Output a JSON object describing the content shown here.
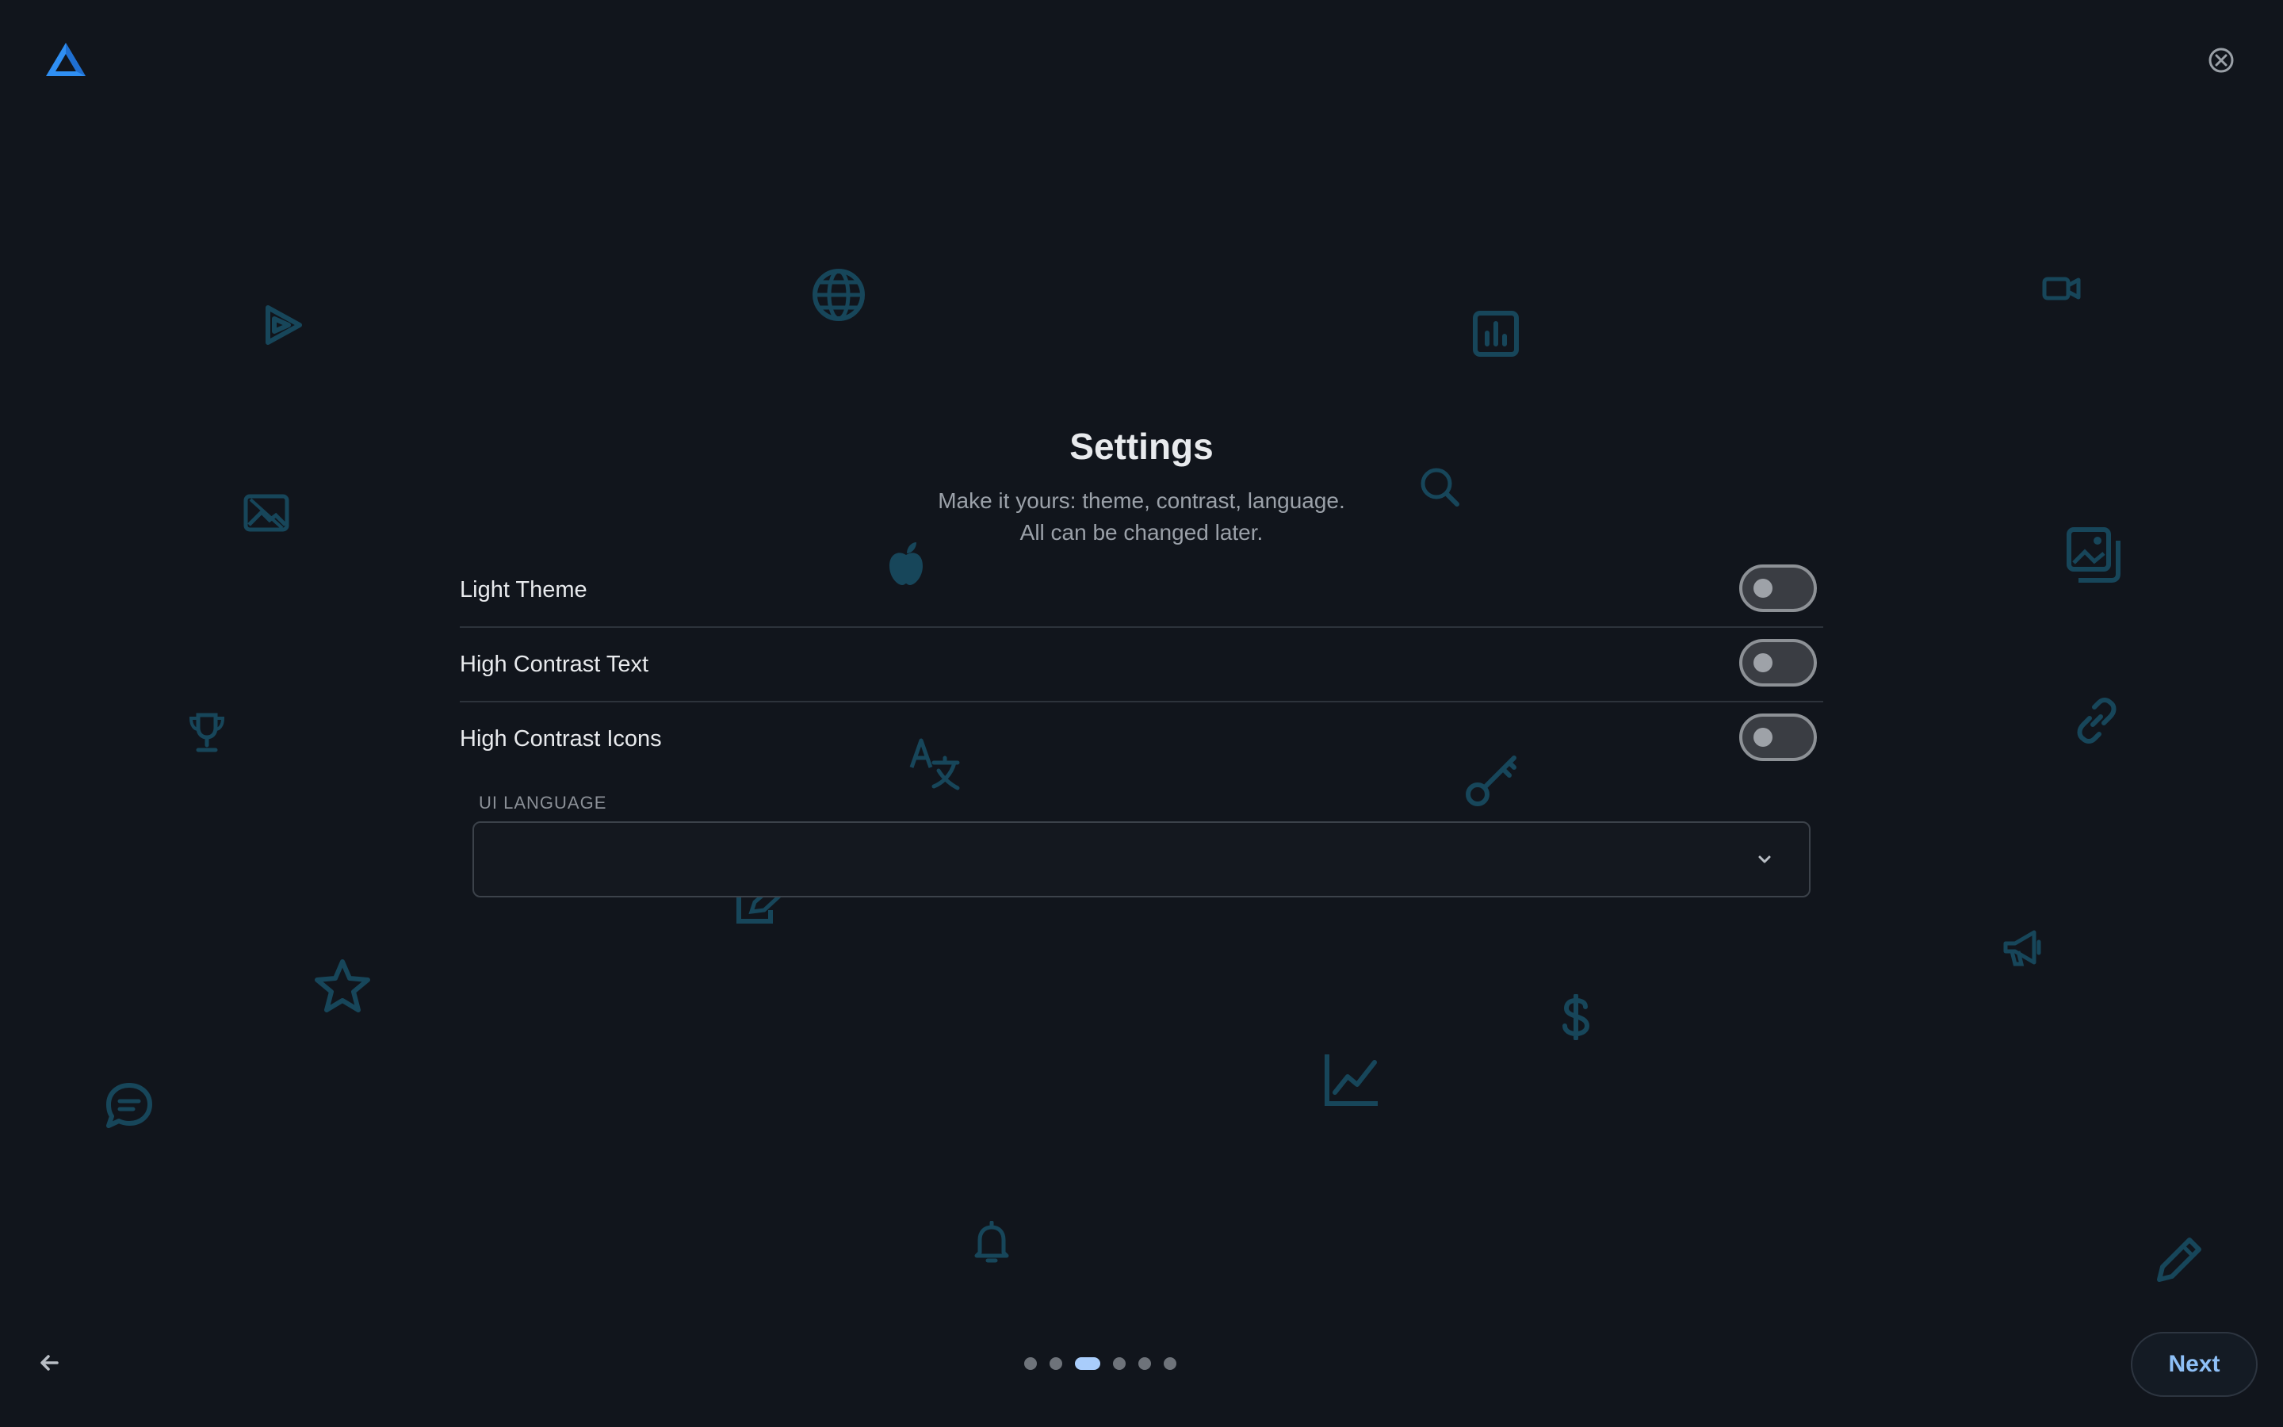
{
  "header": {
    "logo_icon": "app-logo-triangle",
    "close_icon": "close-circle-icon"
  },
  "page": {
    "title": "Settings",
    "subtitle_line1": "Make it yours: theme, contrast, language.",
    "subtitle_line2": "All can be changed later."
  },
  "settings": {
    "rows": [
      {
        "label": "Light Theme",
        "enabled": false
      },
      {
        "label": "High Contrast Text",
        "enabled": false
      },
      {
        "label": "High Contrast Icons",
        "enabled": false
      }
    ]
  },
  "language": {
    "label": "UI LANGUAGE",
    "value": ""
  },
  "footer": {
    "next_label": "Next",
    "back_icon": "arrow-left-icon",
    "steps_total": 6,
    "current_step": 3
  },
  "colors": {
    "background": "#11151c",
    "decor_icon": "#17465a",
    "accent": "#8ec0f7",
    "logo": "#2f8ff3"
  }
}
